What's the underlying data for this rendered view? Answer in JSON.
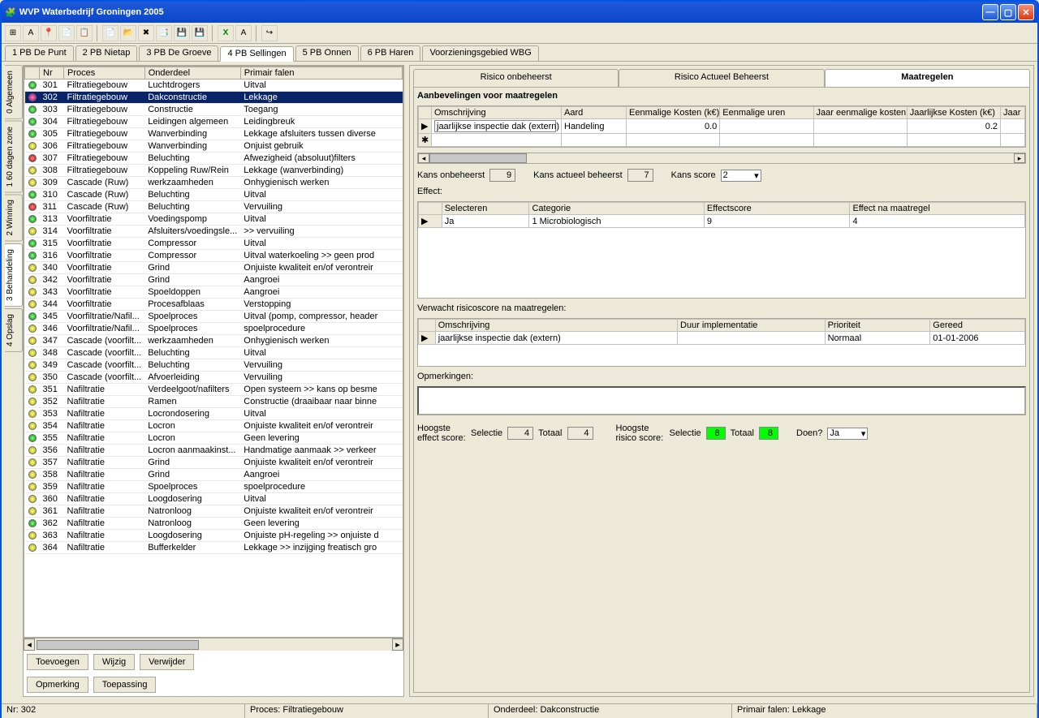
{
  "window": {
    "title": "WVP Waterbedrijf Groningen 2005"
  },
  "topTabs": [
    {
      "label": "1 PB De Punt",
      "active": false
    },
    {
      "label": "2 PB Nietap",
      "active": false
    },
    {
      "label": "3 PB De Groeve",
      "active": false
    },
    {
      "label": "4 PB Sellingen",
      "active": true
    },
    {
      "label": "5 PB Onnen",
      "active": false
    },
    {
      "label": "6 PB Haren",
      "active": false
    },
    {
      "label": "Voorzieningsgebied WBG",
      "active": false
    }
  ],
  "sideTabs": [
    {
      "label": "0 Algemeen",
      "active": false
    },
    {
      "label": "1 60 dagen zone",
      "active": false
    },
    {
      "label": "2 Winning",
      "active": false
    },
    {
      "label": "3 Behandeling",
      "active": true
    },
    {
      "label": "4 Opslag",
      "active": false
    }
  ],
  "gridHeaders": [
    "",
    "Nr",
    "Proces",
    "Onderdeel",
    "Primair falen"
  ],
  "rows": [
    {
      "c": "g",
      "nr": "301",
      "p": "Filtratiegebouw",
      "o": "Luchtdrogers",
      "f": "Uitval"
    },
    {
      "c": "p",
      "nr": "302",
      "p": "Filtratiegebouw",
      "o": "Dakconstructie",
      "f": "Lekkage",
      "sel": true
    },
    {
      "c": "g",
      "nr": "303",
      "p": "Filtratiegebouw",
      "o": "Constructie",
      "f": "Toegang"
    },
    {
      "c": "g",
      "nr": "304",
      "p": "Filtratiegebouw",
      "o": "Leidingen algemeen",
      "f": "Leidingbreuk"
    },
    {
      "c": "g",
      "nr": "305",
      "p": "Filtratiegebouw",
      "o": "Wanverbinding",
      "f": "Lekkage afsluiters tussen diverse"
    },
    {
      "c": "y",
      "nr": "306",
      "p": "Filtratiegebouw",
      "o": "Wanverbinding",
      "f": "Onjuist gebruik"
    },
    {
      "c": "r",
      "nr": "307",
      "p": "Filtratiegebouw",
      "o": "Beluchting",
      "f": "Afwezigheid (absoluut)filters"
    },
    {
      "c": "y",
      "nr": "308",
      "p": "Filtratiegebouw",
      "o": "Koppeling Ruw/Rein",
      "f": "Lekkage (wanverbinding)"
    },
    {
      "c": "y",
      "nr": "309",
      "p": "Cascade (Ruw)",
      "o": "werkzaamheden",
      "f": "Onhygienisch werken"
    },
    {
      "c": "g",
      "nr": "310",
      "p": "Cascade (Ruw)",
      "o": "Beluchting",
      "f": "Uitval"
    },
    {
      "c": "r",
      "nr": "311",
      "p": "Cascade (Ruw)",
      "o": "Beluchting",
      "f": "Vervuiling"
    },
    {
      "c": "g",
      "nr": "313",
      "p": "Voorfiltratie",
      "o": "Voedingspomp",
      "f": "Uitval"
    },
    {
      "c": "y",
      "nr": "314",
      "p": "Voorfiltratie",
      "o": "Afsluiters/voedingsle...",
      "f": ">> vervuiling"
    },
    {
      "c": "g",
      "nr": "315",
      "p": "Voorfiltratie",
      "o": "Compressor",
      "f": "Uitval"
    },
    {
      "c": "g",
      "nr": "316",
      "p": "Voorfiltratie",
      "o": "Compressor",
      "f": "Uitval waterkoeling >> geen prod"
    },
    {
      "c": "y",
      "nr": "340",
      "p": "Voorfiltratie",
      "o": "Grind",
      "f": "Onjuiste kwaliteit en/of verontreir"
    },
    {
      "c": "y",
      "nr": "342",
      "p": "Voorfiltratie",
      "o": "Grind",
      "f": "Aangroei"
    },
    {
      "c": "y",
      "nr": "343",
      "p": "Voorfiltratie",
      "o": "Spoeldoppen",
      "f": "Aangroei"
    },
    {
      "c": "y",
      "nr": "344",
      "p": "Voorfiltratie",
      "o": "Procesafblaas",
      "f": "Verstopping"
    },
    {
      "c": "g",
      "nr": "345",
      "p": "Voorfiltratie/Nafil...",
      "o": "Spoelproces",
      "f": "Uitval (pomp, compressor, header"
    },
    {
      "c": "y",
      "nr": "346",
      "p": "Voorfiltratie/Nafil...",
      "o": "Spoelproces",
      "f": "spoelprocedure"
    },
    {
      "c": "y",
      "nr": "347",
      "p": "Cascade (voorfilt...",
      "o": "werkzaamheden",
      "f": "Onhygienisch werken"
    },
    {
      "c": "y",
      "nr": "348",
      "p": "Cascade (voorfilt...",
      "o": "Beluchting",
      "f": "Uitval"
    },
    {
      "c": "y",
      "nr": "349",
      "p": "Cascade (voorfilt...",
      "o": "Beluchting",
      "f": "Vervuiling"
    },
    {
      "c": "y",
      "nr": "350",
      "p": "Cascade (voorfilt...",
      "o": "Afvoerleiding",
      "f": "Vervuiling"
    },
    {
      "c": "y",
      "nr": "351",
      "p": "Nafiltratie",
      "o": "Verdeelgoot/nafilters",
      "f": "Open systeem >> kans op besme"
    },
    {
      "c": "y",
      "nr": "352",
      "p": "Nafiltratie",
      "o": "Ramen",
      "f": "Constructie (draaibaar naar binne"
    },
    {
      "c": "y",
      "nr": "353",
      "p": "Nafiltratie",
      "o": "Locrondosering",
      "f": "Uitval"
    },
    {
      "c": "y",
      "nr": "354",
      "p": "Nafiltratie",
      "o": "Locron",
      "f": "Onjuiste kwaliteit en/of verontreir"
    },
    {
      "c": "g",
      "nr": "355",
      "p": "Nafiltratie",
      "o": "Locron",
      "f": "Geen levering"
    },
    {
      "c": "y",
      "nr": "356",
      "p": "Nafiltratie",
      "o": "Locron aanmaakinst...",
      "f": "Handmatige aanmaak >> verkeer"
    },
    {
      "c": "y",
      "nr": "357",
      "p": "Nafiltratie",
      "o": "Grind",
      "f": "Onjuiste kwaliteit en/of verontreir"
    },
    {
      "c": "y",
      "nr": "358",
      "p": "Nafiltratie",
      "o": "Grind",
      "f": "Aangroei"
    },
    {
      "c": "y",
      "nr": "359",
      "p": "Nafiltratie",
      "o": "Spoelproces",
      "f": "spoelprocedure"
    },
    {
      "c": "y",
      "nr": "360",
      "p": "Nafiltratie",
      "o": "Loogdosering",
      "f": "Uitval"
    },
    {
      "c": "y",
      "nr": "361",
      "p": "Nafiltratie",
      "o": "Natronloog",
      "f": "Onjuiste kwaliteit en/of verontreir"
    },
    {
      "c": "g",
      "nr": "362",
      "p": "Nafiltratie",
      "o": "Natronloog",
      "f": "Geen levering"
    },
    {
      "c": "y",
      "nr": "363",
      "p": "Nafiltratie",
      "o": "Loogdosering",
      "f": "Onjuiste pH-regeling >> onjuiste d"
    },
    {
      "c": "y",
      "nr": "364",
      "p": "Nafiltratie",
      "o": "Bufferkelder",
      "f": "Lekkage >> inzijging freatisch gro"
    }
  ],
  "leftButtons": {
    "toevoegen": "Toevoegen",
    "wijzig": "Wijzig",
    "verwijder": "Verwijder",
    "opmerking": "Opmerking",
    "toepassing": "Toepassing"
  },
  "rightTabs": [
    {
      "label": "Risico onbeheerst",
      "active": false
    },
    {
      "label": "Risico Actueel Beheerst",
      "active": false
    },
    {
      "label": "Maatregelen",
      "active": true
    }
  ],
  "aanbev": {
    "title": "Aanbevelingen voor maatregelen",
    "headers": [
      "Omschrijving",
      "Aard",
      "Eenmalige Kosten (k€)",
      "Eenmalige uren",
      "Jaar eenmalige kosten",
      "Jaarlijkse Kosten (k€)",
      "Jaar"
    ],
    "row": {
      "oms": "jaarlijkse inspectie dak (extern)",
      "aard": "Handeling",
      "eenk": "0.0",
      "jaar": "0.2"
    }
  },
  "kans": {
    "onbeheerst_label": "Kans onbeheerst",
    "onbeheerst": "9",
    "actueel_label": "Kans actueel beheerst",
    "actueel": "7",
    "score_label": "Kans score",
    "score": "2"
  },
  "effect": {
    "label": "Effect:",
    "headers": [
      "Selecteren",
      "Categorie",
      "Effectscore",
      "Effect na maatregel"
    ],
    "row": {
      "sel": "Ja",
      "cat": "1 Microbiologisch",
      "score": "9",
      "na": "4"
    }
  },
  "verwacht": {
    "label": "Verwacht risicoscore na maatregelen:",
    "headers": [
      "Omschrijving",
      "Duur implementatie",
      "Prioriteit",
      "Gereed"
    ],
    "row": {
      "oms": "jaarlijkse inspectie dak (extern)",
      "duur": "",
      "prio": "Normaal",
      "gereed": "01-01-2006"
    }
  },
  "opm": {
    "label": "Opmerkingen:"
  },
  "footer": {
    "effect_label": "Hoogste effect score:",
    "selectie_l": "Selectie",
    "sel_v": "4",
    "totaal_l": "Totaal",
    "tot_v": "4",
    "risico_label": "Hoogste risico score:",
    "rsel": "8",
    "rtot": "8",
    "doen_l": "Doen?",
    "doen_v": "Ja"
  },
  "status": {
    "nr": "Nr: 302",
    "proces": "Proces: Filtratiegebouw",
    "ond": "Onderdeel: Dakconstructie",
    "fal": "Primair falen: Lekkage"
  }
}
